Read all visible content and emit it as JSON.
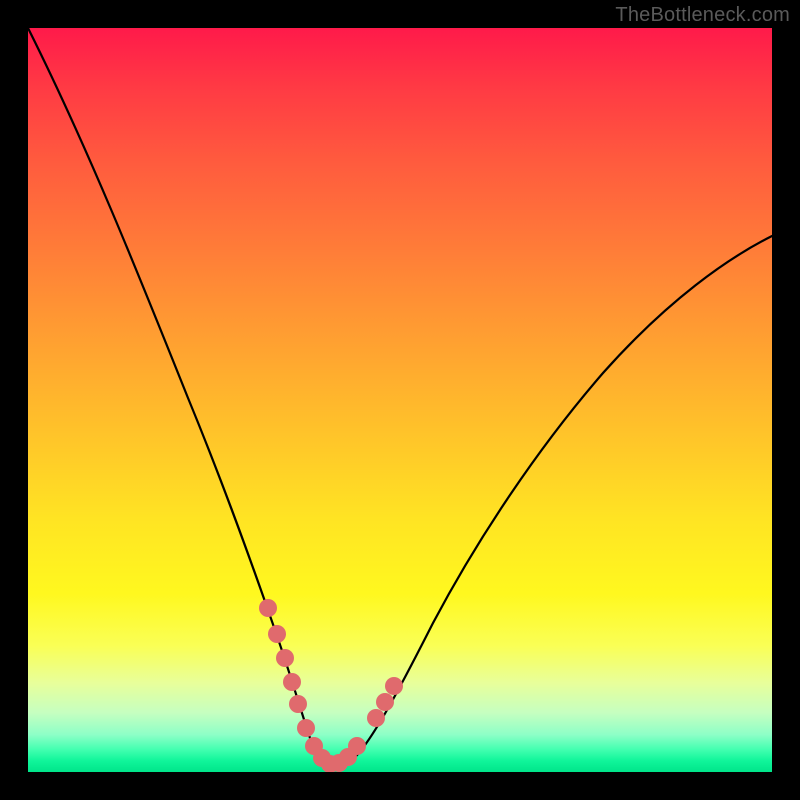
{
  "watermark": "TheBottleneck.com",
  "chart_data": {
    "type": "line",
    "title": "",
    "xlabel": "",
    "ylabel": "",
    "xlim": [
      0,
      100
    ],
    "ylim": [
      0,
      100
    ],
    "x": [
      0,
      5,
      10,
      15,
      20,
      25,
      28,
      30,
      32,
      34,
      35,
      36,
      38,
      40,
      42,
      44,
      46,
      50,
      55,
      60,
      65,
      70,
      75,
      80,
      85,
      90,
      95,
      100
    ],
    "y": [
      100,
      84,
      69,
      55,
      42,
      30,
      23,
      19,
      14,
      8,
      5,
      3,
      1,
      0.5,
      0.5,
      1.5,
      4,
      10,
      19,
      28,
      36,
      43,
      50,
      56,
      61,
      65,
      68,
      70
    ],
    "highlight_segments": [
      {
        "x": [
          28.5,
          30.5,
          32.2,
          33.8
        ],
        "y": [
          22.5,
          17.8,
          13.0,
          8.6
        ]
      },
      {
        "x": [
          35.0,
          36.3,
          37.6,
          38.9,
          40.2,
          41.5,
          42.8
        ],
        "y": [
          4.8,
          2.9,
          1.6,
          0.9,
          0.7,
          1.0,
          1.8
        ]
      },
      {
        "x": [
          45.2,
          46.6,
          48.0
        ],
        "y": [
          5.2,
          7.3,
          9.6
        ]
      }
    ],
    "annotations": []
  },
  "colors": {
    "curve": "#000000",
    "highlight": "#e06a6d",
    "background_top": "#ff1a4a",
    "background_bottom": "#00e58a"
  }
}
